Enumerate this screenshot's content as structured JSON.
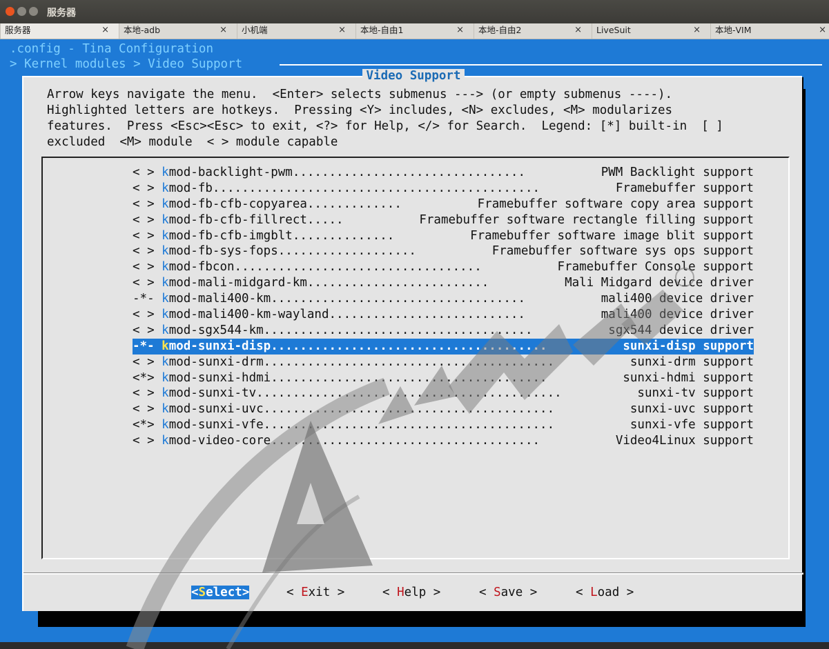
{
  "window": {
    "title": "服务器"
  },
  "tabs": [
    {
      "label": "服务器",
      "active": true
    },
    {
      "label": "本地-adb",
      "active": false
    },
    {
      "label": "小机端",
      "active": false
    },
    {
      "label": "本地-自由1",
      "active": false
    },
    {
      "label": "本地-自由2",
      "active": false
    },
    {
      "label": "LiveSuit",
      "active": false
    },
    {
      "label": "本地-VIM",
      "active": false
    }
  ],
  "tab_close_glyph": "×",
  "header": {
    "config_line": ".config - Tina Configuration",
    "breadcrumb": "> Kernel modules > Video Support"
  },
  "dialog": {
    "title": "Video Support",
    "help_text": "Arrow keys navigate the menu.  <Enter> selects submenus ---> (or empty submenus ----).\nHighlighted letters are hotkeys.  Pressing <Y> includes, <N> excludes, <M> modularizes\nfeatures.  Press <Esc><Esc> to exit, <?> for Help, </> for Search.  Legend: [*] built-in  [ ]\nexcluded  <M> module  < > module capable"
  },
  "menu_items": [
    {
      "state": "< >",
      "hotkey": "k",
      "name": "mod-backlight-pwm",
      "desc": "PWM Backlight support",
      "selected": false
    },
    {
      "state": "< >",
      "hotkey": "k",
      "name": "mod-fb",
      "desc": "Framebuffer support",
      "selected": false
    },
    {
      "state": "< >",
      "hotkey": "k",
      "name": "mod-fb-cfb-copyarea",
      "desc": "Framebuffer software copy area support",
      "selected": false
    },
    {
      "state": "< >",
      "hotkey": "k",
      "name": "mod-fb-cfb-fillrect",
      "desc": "Framebuffer software rectangle filling support",
      "selected": false
    },
    {
      "state": "< >",
      "hotkey": "k",
      "name": "mod-fb-cfb-imgblt",
      "desc": "Framebuffer software image blit support",
      "selected": false
    },
    {
      "state": "< >",
      "hotkey": "k",
      "name": "mod-fb-sys-fops",
      "desc": "Framebuffer software sys ops support",
      "selected": false
    },
    {
      "state": "< >",
      "hotkey": "k",
      "name": "mod-fbcon",
      "desc": "Framebuffer Console support",
      "selected": false
    },
    {
      "state": "< >",
      "hotkey": "k",
      "name": "mod-mali-midgard-km",
      "desc": "Mali Midgard device driver",
      "selected": false
    },
    {
      "state": "-*-",
      "hotkey": "k",
      "name": "mod-mali400-km",
      "desc": "mali400 device driver",
      "selected": false
    },
    {
      "state": "< >",
      "hotkey": "k",
      "name": "mod-mali400-km-wayland",
      "desc": "mali400 device driver",
      "selected": false
    },
    {
      "state": "< >",
      "hotkey": "k",
      "name": "mod-sgx544-km",
      "desc": "sgx544 device driver",
      "selected": false
    },
    {
      "state": "-*-",
      "hotkey": "k",
      "name": "mod-sunxi-disp",
      "desc": "sunxi-disp support",
      "selected": true
    },
    {
      "state": "< >",
      "hotkey": "k",
      "name": "mod-sunxi-drm",
      "desc": "sunxi-drm support",
      "selected": false
    },
    {
      "state": "<*>",
      "hotkey": "k",
      "name": "mod-sunxi-hdmi",
      "desc": "sunxi-hdmi support",
      "selected": false
    },
    {
      "state": "< >",
      "hotkey": "k",
      "name": "mod-sunxi-tv",
      "desc": "sunxi-tv support",
      "selected": false
    },
    {
      "state": "< >",
      "hotkey": "k",
      "name": "mod-sunxi-uvc",
      "desc": "sunxi-uvc support",
      "selected": false
    },
    {
      "state": "<*>",
      "hotkey": "k",
      "name": "mod-sunxi-vfe",
      "desc": "sunxi-vfe support",
      "selected": false
    },
    {
      "state": "< >",
      "hotkey": "k",
      "name": "mod-video-core",
      "desc": "Video4Linux support",
      "selected": false
    }
  ],
  "buttons": [
    {
      "pre": "<",
      "hotkey": "S",
      "post": "elect>",
      "active": true
    },
    {
      "pre": "< ",
      "hotkey": "E",
      "post": "xit >",
      "active": false
    },
    {
      "pre": "< ",
      "hotkey": "H",
      "post": "elp >",
      "active": false
    },
    {
      "pre": "< ",
      "hotkey": "S",
      "post": "ave >",
      "active": false
    },
    {
      "pre": "< ",
      "hotkey": "L",
      "post": "oad >",
      "active": false
    }
  ],
  "colors": {
    "terminal_bg": "#1e7ad6",
    "dialog_bg": "#e4e4e4",
    "hotkey_blue": "#1e7ad6",
    "hotkey_red": "#c0141c",
    "selected_hotkey": "#ffe34d"
  }
}
